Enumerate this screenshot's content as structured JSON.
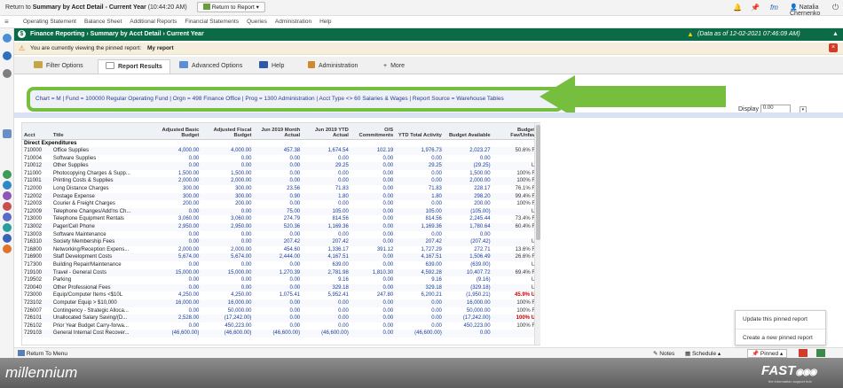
{
  "topbar": {
    "return_prefix": "Return to",
    "return_target": "Summary by Acct Detail - Current Year",
    "return_time": "(10:44:20 AM)",
    "return_report_btn": "Return to Report",
    "user": "Natalia Chernenko",
    "fm_label": "fm"
  },
  "menu": [
    "Operating Statement",
    "Balance Sheet",
    "Additional Reports",
    "Financial Statements",
    "Queries",
    "Administration",
    "Help"
  ],
  "breadcrumb": {
    "text": "Finance Reporting › Summary by Acct Detail › Current Year",
    "data_as_of": "(Data as of 12-02-2021 07:46:09 AM)"
  },
  "notice": {
    "prefix": "You are currently viewing the pinned report:",
    "report": "My report"
  },
  "tabs": [
    {
      "label": "Filter Options"
    },
    {
      "label": "Report Results"
    },
    {
      "label": "Advanced Options"
    },
    {
      "label": "Help"
    },
    {
      "label": "Administration"
    },
    {
      "label": "More"
    }
  ],
  "criteria": "Chart = M  |  Fund = 100000 Regular Operating Fund  |  Orgn = 498 Finance Office  |  Prog = 1300 Administration  |  Acct Type <> 60 Salaries & Wages  |  Report Source = Warehouse Tables",
  "display": {
    "label": "Display",
    "value": "0.00"
  },
  "table": {
    "headers": [
      "Acct",
      "Title",
      "Adjusted Basic Budget",
      "Adjusted Fiscal Budget",
      "Jun 2019 Month Actual",
      "Jun 2019 YTD Actual",
      "O/S Commitments",
      "YTD Total Activity",
      "Budget Available",
      "Budget Fav/Unfav"
    ],
    "section": "Direct Expenditures",
    "rows": [
      [
        "710000",
        "Office Supplies",
        "4,000.00",
        "4,000.00",
        "457.38",
        "1,674.54",
        "102.19",
        "1,976.73",
        "2,023.27",
        "50.6% F"
      ],
      [
        "710004",
        "Software Supplies",
        "0.00",
        "0.00",
        "0.00",
        "0.00",
        "0.00",
        "0.00",
        "0.00",
        ""
      ],
      [
        "710012",
        "Other Supplies",
        "0.00",
        "0.00",
        "0.00",
        "29.25",
        "0.00",
        "29.25",
        "(29.25)",
        "U"
      ],
      [
        "711000",
        "Photocopying Charges & Supp...",
        "1,500.00",
        "1,500.00",
        "0.00",
        "0.00",
        "0.00",
        "0.00",
        "1,500.00",
        "100% F"
      ],
      [
        "711001",
        "Printing Costs & Supplies",
        "2,000.00",
        "2,000.00",
        "0.00",
        "0.00",
        "0.00",
        "0.00",
        "2,000.00",
        "100% F"
      ],
      [
        "712000",
        "Long Distance Charges",
        "300.00",
        "300.00",
        "23.56",
        "71.83",
        "0.00",
        "71.83",
        "228.17",
        "76.1% F"
      ],
      [
        "712002",
        "Postage Expense",
        "300.00",
        "300.00",
        "0.90",
        "1.80",
        "0.00",
        "1.80",
        "298.20",
        "99.4% F"
      ],
      [
        "712003",
        "Courier & Freight Charges",
        "200.00",
        "200.00",
        "0.00",
        "0.00",
        "0.00",
        "0.00",
        "200.00",
        "100% F"
      ],
      [
        "712009",
        "Telephone Changes/Add'ns Ch...",
        "0.00",
        "0.00",
        "75.00",
        "105.00",
        "0.00",
        "105.00",
        "(105.00)",
        "U"
      ],
      [
        "713000",
        "Telephone Equipment Rentals",
        "3,060.00",
        "3,060.00",
        "274.79",
        "814.56",
        "0.00",
        "814.56",
        "2,245.44",
        "73.4% F"
      ],
      [
        "713002",
        "Pager/Cell Phone",
        "2,950.00",
        "2,950.00",
        "520.36",
        "1,169.36",
        "0.00",
        "1,169.36",
        "1,780.64",
        "60.4% F"
      ],
      [
        "713003",
        "Software Maintenance",
        "0.00",
        "0.00",
        "0.00",
        "0.00",
        "0.00",
        "0.00",
        "0.00",
        ""
      ],
      [
        "716310",
        "Society Membership Fees",
        "0.00",
        "0.00",
        "207.42",
        "207.42",
        "0.00",
        "207.42",
        "(207.42)",
        "U"
      ],
      [
        "716800",
        "Networking/Reception Expens...",
        "2,000.00",
        "2,000.00",
        "454.60",
        "1,336.17",
        "391.12",
        "1,727.29",
        "272.71",
        "13.6% F"
      ],
      [
        "716900",
        "Staff Development Costs",
        "5,674.00",
        "5,674.00",
        "2,444.00",
        "4,167.51",
        "0.00",
        "4,167.51",
        "1,506.49",
        "26.6% F"
      ],
      [
        "717300",
        "Building Repair/Maintenance",
        "0.00",
        "0.00",
        "0.00",
        "639.00",
        "0.00",
        "639.00",
        "(639.00)",
        "U"
      ],
      [
        "719100",
        "Travel - General Costs",
        "15,000.00",
        "15,000.00",
        "1,270.39",
        "2,781.98",
        "1,810.30",
        "4,592.28",
        "10,407.72",
        "69.4% F"
      ],
      [
        "719502",
        "Parking",
        "0.00",
        "0.00",
        "0.00",
        "9.16",
        "0.00",
        "9.16",
        "(9.16)",
        "U"
      ],
      [
        "720040",
        "Other Professional Fees",
        "0.00",
        "0.00",
        "0.00",
        "329.18",
        "0.00",
        "329.18",
        "(329.18)",
        "U"
      ],
      [
        "723000",
        "Equip/Computer Items <$10L",
        "4,250.00",
        "4,250.00",
        "1,075.41",
        "5,952.41",
        "247.80",
        "6,200.21",
        "(1,950.21)",
        "45.9% U"
      ],
      [
        "723102",
        "Computer Equip > $10,000",
        "16,000.00",
        "16,000.00",
        "0.00",
        "0.00",
        "0.00",
        "0.00",
        "16,000.00",
        "100% F"
      ],
      [
        "726007",
        "Contingency - Strategic Alloca...",
        "0.00",
        "50,000.00",
        "0.00",
        "0.00",
        "0.00",
        "0.00",
        "50,000.00",
        "100% F"
      ],
      [
        "726101",
        "Unallocated Salary Saving/(D...",
        "2,528.00",
        "(17,242.00)",
        "0.00",
        "0.00",
        "0.00",
        "0.00",
        "(17,242.00)",
        "100% U"
      ],
      [
        "726102",
        "Prior Year Budget Carry-forwa...",
        "0.00",
        "450,223.00",
        "0.00",
        "0.00",
        "0.00",
        "0.00",
        "450,223.00",
        "100% F"
      ],
      [
        "729103",
        "General Internal Cost Recover...",
        "(46,600.00)",
        "(46,600.00)",
        "(46,600.00)",
        "(46,600.00)",
        "0.00",
        "(46,600.00)",
        "0.00",
        ""
      ]
    ]
  },
  "bottom": {
    "return_menu": "Return To Menu",
    "notes": "Notes",
    "schedule": "Schedule",
    "pinned": "Pinned"
  },
  "popup": {
    "update": "Update this pinned report",
    "create": "Create a new pinned report"
  },
  "footer": {
    "left": "millennium",
    "right": "FAST",
    "tagline": "the information support hub"
  },
  "colors": {
    "header_green": "#0b6b47",
    "highlight_green": "#76be3d",
    "link_blue": "#1b3d9a",
    "unfav_red": "#cc0000"
  }
}
